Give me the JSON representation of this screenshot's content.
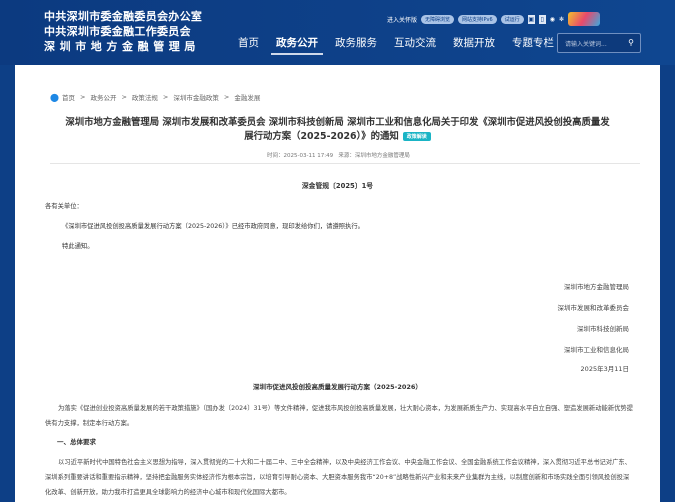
{
  "header": {
    "org_lines": [
      "中共深圳市委金融委员会办公室",
      "中共深圳市委金融工作委员会",
      "深圳市地方金融管理局"
    ],
    "tools": {
      "care": "进入关怀版",
      "pills": [
        "无障碍浏览",
        "网站支持IPv6",
        "试运行"
      ]
    },
    "nav": [
      "首页",
      "政务公开",
      "政务服务",
      "互动交流",
      "数据开放",
      "专题专栏"
    ],
    "search_placeholder": "请输入关键词..."
  },
  "breadcrumb": [
    "首页",
    "政务公开",
    "政策法规",
    "深圳市金融政策",
    "金融发展"
  ],
  "article": {
    "title_line1": "深圳市地方金融管理局 深圳市发展和改革委员会 深圳市科技创新局 深圳市工业和信息化局关于印发《深圳市促进风投创投高质量发",
    "title_line2": "展行动方案（2025-2026）》的通知",
    "tag": "政策解读",
    "time": "时间：2025-03-11 17:49",
    "source": "来源：深圳市地方金融管理局",
    "doc_no": "深金管规〔2025〕1号",
    "salutation": "各有关单位：",
    "para1": "《深圳市促进风投创投高质量发展行动方案（2025-2026）》已经市政府同意，现印发给你们，请遵照执行。",
    "closing": "特此通知。",
    "signatures": [
      "深圳市地方金融管理局",
      "深圳市发展和改革委员会",
      "深圳市科技创新局",
      "深圳市工业和信息化局",
      "2025年3月11日"
    ],
    "plan_title": "深圳市促进风投创投高质量发展行动方案（2025-2026）",
    "plan_para1": "为落实《促进创业投资高质量发展的若干政策措施》（国办发〔2024〕31号）等文件精神，促进我市风投创投高质量发展，壮大耐心资本，为发展新质生产力、实现高水平自立自强、塑造发展新动能新优势提供有力支撑，制定本行动方案。",
    "section1": "一、总体要求",
    "plan_para2": "以习近平新时代中国特色社会主义思想为指导，深入贯彻党的二十大和二十届二中、三中全会精神，以及中央经济工作会议、中央金融工作会议、全国金融系统工作会议精神，深入贯彻习近平总书记对广东、深圳系列重要讲话和重要指示精神，坚持把金融服务实体经济作为根本宗旨，以培育引导耐心资本、大胆资本服务我市“20+8”战略性新兴产业和未来产业集群为主线，以制度创新和市场实践全面引领风投创投深化改革、创新开放，助力我市打造更具全球影响力的经济中心城市和现代化国际大都市。"
  }
}
